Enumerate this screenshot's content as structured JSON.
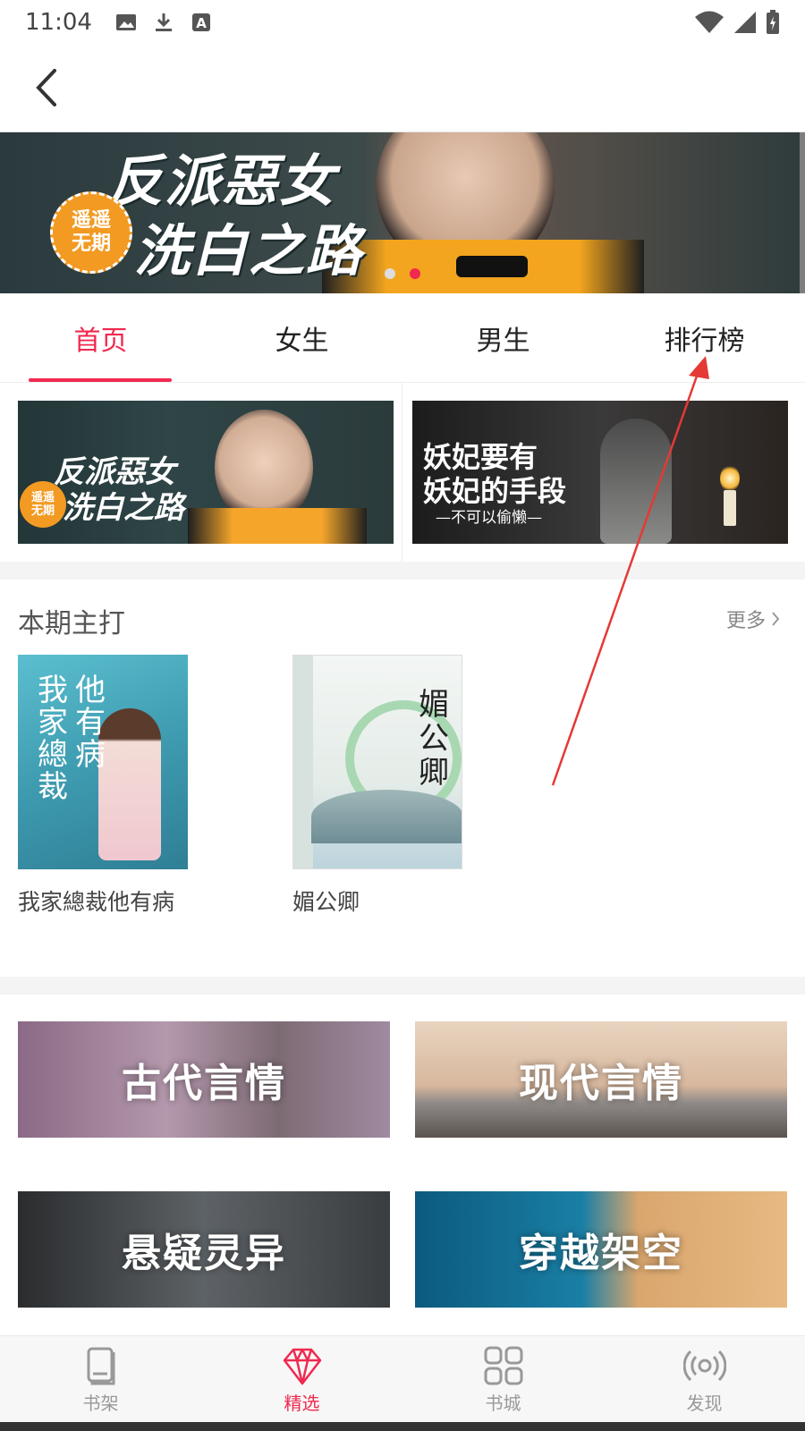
{
  "status_bar": {
    "time": "11:04"
  },
  "hero": {
    "title_line1": "反派惡女",
    "title_line2": "洗白之路",
    "badge_line1": "遥遥",
    "badge_line2": "无期",
    "slide_count": 2,
    "active_slide": 2
  },
  "tabs": [
    {
      "label": "首页",
      "active": true
    },
    {
      "label": "女生",
      "active": false
    },
    {
      "label": "男生",
      "active": false
    },
    {
      "label": "排行榜",
      "active": false
    }
  ],
  "promos": {
    "left": {
      "title_line1": "反派惡女",
      "title_line2": "洗白之路",
      "badge_line1": "遥遥",
      "badge_line2": "无期"
    },
    "right": {
      "title_line1": "妖妃要有",
      "title_line2": "妖妃的手段",
      "subtitle": "—不可以偷懒—"
    }
  },
  "featured": {
    "title": "本期主打",
    "more_label": "更多",
    "books": [
      {
        "name": "我家總裁他有病",
        "cover_line1": "我家總裁",
        "cover_line2": "他有病"
      },
      {
        "name": "媚公卿",
        "cover_title": "媚公卿"
      }
    ]
  },
  "categories": [
    {
      "label": "古代言情"
    },
    {
      "label": "现代言情"
    },
    {
      "label": "悬疑灵异"
    },
    {
      "label": "穿越架空"
    }
  ],
  "bottom_nav": [
    {
      "label": "书架",
      "icon": "book-icon",
      "active": false
    },
    {
      "label": "精选",
      "icon": "diamond-icon",
      "active": true
    },
    {
      "label": "书城",
      "icon": "grid-icon",
      "active": false
    },
    {
      "label": "发现",
      "icon": "broadcast-icon",
      "active": false
    }
  ],
  "colors": {
    "accent": "#f0294f",
    "annotation_arrow": "#e53935"
  }
}
